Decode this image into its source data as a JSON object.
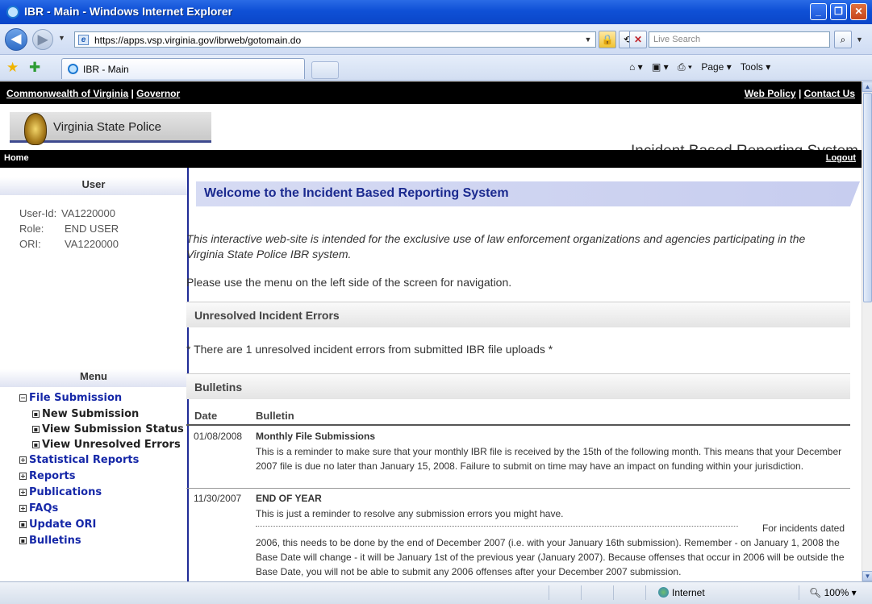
{
  "window": {
    "title": "IBR - Main - Windows Internet Explorer",
    "minimize": "_",
    "maximize": "❐",
    "close": "✕"
  },
  "address": {
    "url": "https://apps.vsp.virginia.gov/ibrweb/gotomain.do",
    "search_placeholder": "Live Search"
  },
  "tab": {
    "label": "IBR - Main"
  },
  "command_bar": {
    "page": "Page ▾",
    "tools": "Tools ▾"
  },
  "header": {
    "left_link_1": "Commonwealth of Virginia",
    "separator": "|",
    "left_link_2": "Governor",
    "right_link_1": "Web Policy",
    "right_link_2": "Contact Us",
    "agency": "Virginia State Police",
    "system": "Incident Based Reporting System",
    "home": "Home",
    "logout": "Logout"
  },
  "sidebar": {
    "user_heading": "User",
    "user_id_label": "User-Id:",
    "user_id": "VA1220000",
    "role_label": "Role:",
    "role": "END USER",
    "ori_label": "ORI:",
    "ori": "VA1220000",
    "menu_heading": "Menu",
    "menu": [
      {
        "label": "File Submission",
        "state": "expanded"
      },
      {
        "label": "New Submission",
        "sub": true
      },
      {
        "label": "View Submission Status",
        "sub": true
      },
      {
        "label": "View Unresolved Errors",
        "sub": true
      },
      {
        "label": "Statistical Reports",
        "state": "collapsed"
      },
      {
        "label": "Reports",
        "state": "collapsed"
      },
      {
        "label": "Publications",
        "state": "collapsed"
      },
      {
        "label": "FAQs",
        "state": "collapsed"
      },
      {
        "label": "Update ORI",
        "state": "leaf"
      },
      {
        "label": "Bulletins",
        "state": "leaf"
      }
    ]
  },
  "main": {
    "welcome_title": "Welcome to the Incident Based Reporting System",
    "intro_line_1": "This interactive web-site is intended for the exclusive use of law enforcement organizations and agencies participating in the",
    "intro_line_2": "Virginia State Police IBR system.",
    "nav_text": "Please use the menu on the left side of the screen for navigation.",
    "errors_heading": "Unresolved Incident Errors",
    "errors_text": "* There are 1 unresolved incident errors from submitted IBR file uploads *",
    "bulletins_heading": "Bulletins",
    "bulletins_columns": [
      "Date",
      "Bulletin"
    ],
    "bulletins": [
      {
        "date": "01/08/2008",
        "title": "Monthly File Submissions",
        "body": "This is a reminder to make sure that your monthly IBR file is received by the 15th of the following month. This means that your December 2007 file is due no later than January 15, 2008. Failure to submit on time may have an impact on funding within your jurisdiction."
      },
      {
        "date": "11/30/2007",
        "title": "END OF YEAR",
        "body_1": "This is just a reminder to resolve any submission errors you might have.",
        "body_2": "For incidents dated",
        "body_3": "2006, this needs to be done by the end of December 2007 (i.e. with your January 16th submission). Remember - on January 1, 2008 the Base Date will change - it will be January 1st of the previous year (January 2007). Because offenses that occur in 2006 will be outside the Base Date, you will not be able to submit any 2006 offenses after your December 2007 submission."
      }
    ]
  },
  "status": {
    "zone": "Internet",
    "zoom": "100%"
  }
}
